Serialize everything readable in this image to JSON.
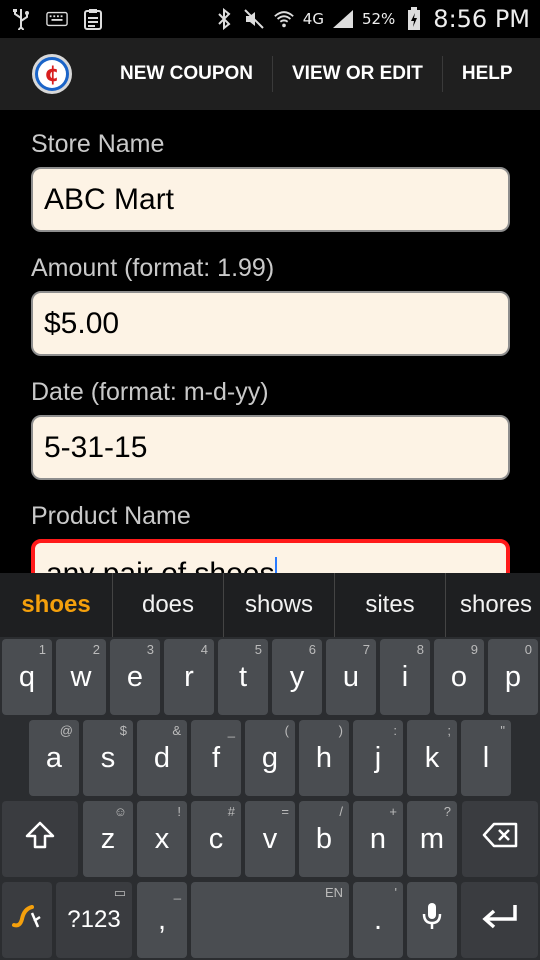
{
  "status_bar": {
    "battery": "52%",
    "time": "8:56 PM",
    "network": "4G",
    "icons": [
      "usb-icon",
      "keyboard-icon",
      "clipboard-icon",
      "bluetooth-icon",
      "mute-icon",
      "wifi-icon",
      "signal-icon",
      "battery-charging-icon"
    ]
  },
  "action_bar": {
    "logo_glyph": "¢",
    "new_coupon": "NEW COUPON",
    "view_or_edit": "VIEW OR EDIT",
    "help": "HELP"
  },
  "form": {
    "store_name_label": "Store Name",
    "store_name_value": "ABC Mart",
    "amount_label": "Amount (format: 1.99)",
    "amount_value": "$5.00",
    "date_label": "Date (format: m-d-yy)",
    "date_value": "5-31-15",
    "product_label": "Product Name",
    "product_value": "any pair of shoes"
  },
  "keyboard": {
    "suggestions": [
      "shoes",
      "does",
      "shows",
      "sites",
      "shores"
    ],
    "row1": [
      {
        "key": "q",
        "hint": "1"
      },
      {
        "key": "w",
        "hint": "2"
      },
      {
        "key": "e",
        "hint": "3"
      },
      {
        "key": "r",
        "hint": "4"
      },
      {
        "key": "t",
        "hint": "5"
      },
      {
        "key": "y",
        "hint": "6"
      },
      {
        "key": "u",
        "hint": "7"
      },
      {
        "key": "i",
        "hint": "8"
      },
      {
        "key": "o",
        "hint": "9"
      },
      {
        "key": "p",
        "hint": "0"
      }
    ],
    "row2": [
      {
        "key": "a",
        "hint": "@"
      },
      {
        "key": "s",
        "hint": "$"
      },
      {
        "key": "d",
        "hint": "&"
      },
      {
        "key": "f",
        "hint": "_"
      },
      {
        "key": "g",
        "hint": "("
      },
      {
        "key": "h",
        "hint": ")"
      },
      {
        "key": "j",
        "hint": ":"
      },
      {
        "key": "k",
        "hint": ";"
      },
      {
        "key": "l",
        "hint": "\""
      }
    ],
    "row3": [
      {
        "key": "z",
        "hint": "☺"
      },
      {
        "key": "x",
        "hint": "!"
      },
      {
        "key": "c",
        "hint": "#"
      },
      {
        "key": "v",
        "hint": "="
      },
      {
        "key": "b",
        "hint": "/"
      },
      {
        "key": "n",
        "hint": "+"
      },
      {
        "key": "m",
        "hint": "?"
      }
    ],
    "symbols_label": "?123",
    "comma": ",",
    "comma_hint": "_",
    "space_hint": "EN",
    "period": ".",
    "period_hint": "'",
    "accent_color": "#f5a00c"
  }
}
